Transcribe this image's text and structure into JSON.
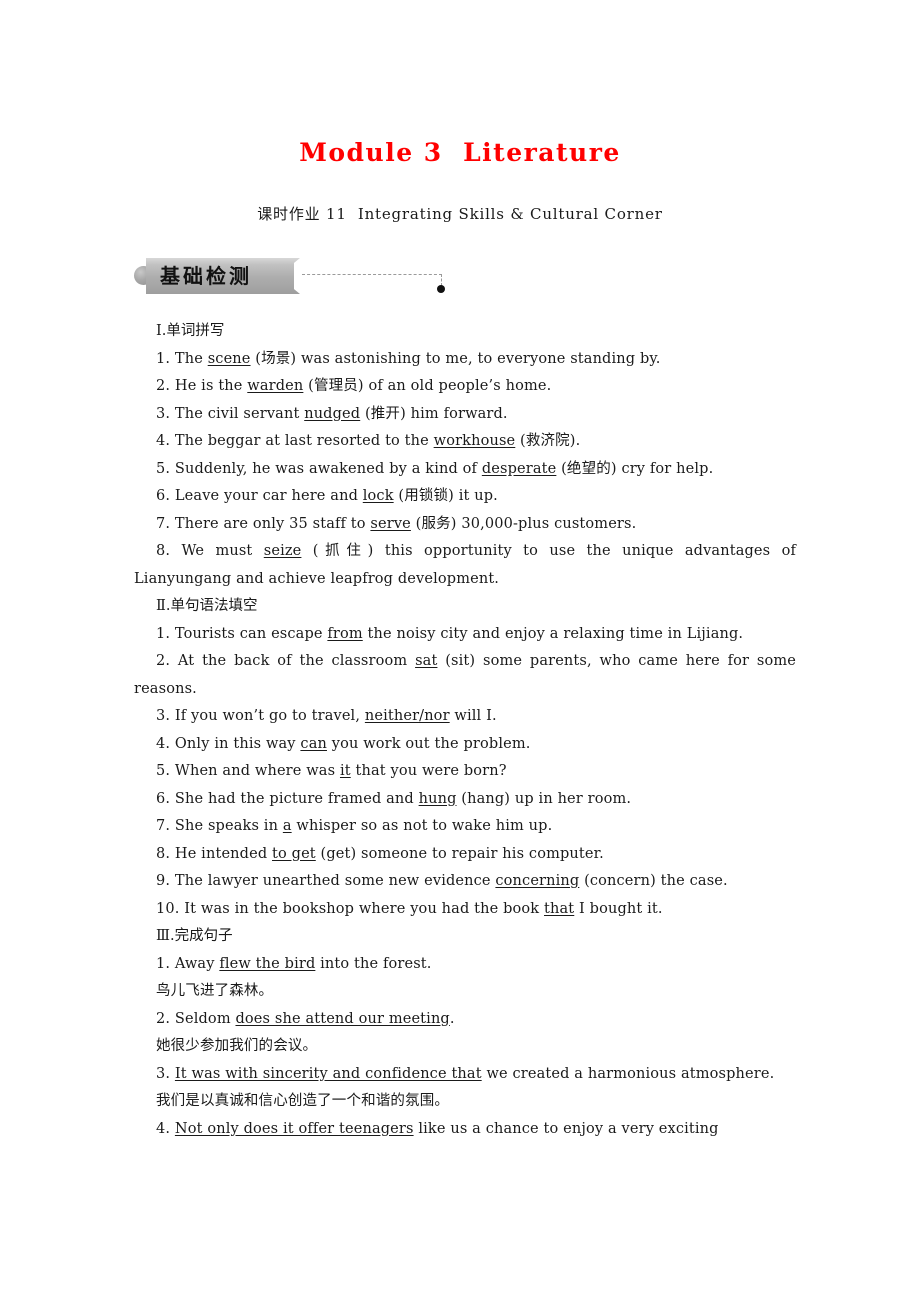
{
  "header": {
    "module_title": "Module 3  Literature",
    "worksheet_title": "课时作业 11  Integrating Skills & Cultural Corner"
  },
  "banner": {
    "label": "基础检测",
    "ribbon_color": "#aeaeae",
    "dash_color": "#9a9a9a",
    "dot_color": "#111111"
  },
  "sections": [
    {
      "heading": "Ⅰ.单词拼写",
      "items": [
        {
          "no": "1.",
          "pre": " The ",
          "ans": "scene",
          "post": " (场景) was astonishing to me, to everyone standing by."
        },
        {
          "no": "2.",
          "pre": " He is the ",
          "ans": "warden",
          "post": " (管理员) of an old people’s home."
        },
        {
          "no": "3.",
          "pre": " The civil servant ",
          "ans": "nudged",
          "post": " (推开) him forward."
        },
        {
          "no": "4.",
          "pre": " The beggar at last resorted to the ",
          "ans": "workhouse",
          "post": " (救济院)."
        },
        {
          "no": "5.",
          "pre": " Suddenly, he was awakened by a kind of ",
          "ans": "desperate",
          "post": " (绝望的) cry for help."
        },
        {
          "no": "6.",
          "pre": " Leave your car here and ",
          "ans": "lock",
          "post": " (用锁锁) it up."
        },
        {
          "no": "7.",
          "pre": " There are only 35 staff to ",
          "ans": "serve",
          "post": " (服务) 30,000-plus customers."
        },
        {
          "no": "8.",
          "pre": " We must ",
          "ans": "seize",
          "post": " (抓住) this opportunity to use the unique advantages of Lianyungang and achieve leapfrog development."
        }
      ]
    },
    {
      "heading": "Ⅱ.单句语法填空",
      "items": [
        {
          "no": "1.",
          "pre": " Tourists can escape ",
          "ans": "from",
          "post": " the noisy city and enjoy a relaxing time in Lijiang."
        },
        {
          "no": "2.",
          "pre": " At the back of the classroom ",
          "ans": "sat",
          "post": " (sit) some parents, who came here for some reasons."
        },
        {
          "no": "3.",
          "pre": " If you won’t go to travel, ",
          "ans": "neither/nor",
          "post": " will I."
        },
        {
          "no": "4.",
          "pre": " Only in this way ",
          "ans": "can",
          "post": " you work out the problem."
        },
        {
          "no": "5.",
          "pre": " When and where was ",
          "ans": "it",
          "post": " that you were born?"
        },
        {
          "no": "6.",
          "pre": " She had the picture framed and ",
          "ans": "hung",
          "post": " (hang) up in her room."
        },
        {
          "no": "7.",
          "pre": " She speaks in ",
          "ans": "a",
          "post": " whisper so as not to wake him up."
        },
        {
          "no": "8.",
          "pre": " He intended ",
          "ans": "to get",
          "post": " (get) someone to repair his computer."
        },
        {
          "no": "9.",
          "pre": " The lawyer unearthed some new evidence ",
          "ans": "concerning",
          "post": " (concern) the case."
        },
        {
          "no": "10.",
          "pre": " It was in the bookshop where you had the book ",
          "ans": "that",
          "post": " I bought it."
        }
      ]
    },
    {
      "heading": "Ⅲ.完成句子",
      "items": [
        {
          "no": "1.",
          "pre": " Away ",
          "ans": "flew the bird",
          "post": " into the forest.",
          "cn": "鸟儿飞进了森林。"
        },
        {
          "no": "2.",
          "pre": " Seldom ",
          "ans": "does she attend our meeting",
          "post": ".",
          "cn": "她很少参加我们的会议。"
        },
        {
          "no": "3.",
          "pre": " ",
          "ans": "It was with sincerity and confidence that",
          "post": " we created a harmonious atmosphere.",
          "cn": "我们是以真诚和信心创造了一个和谐的氛围。"
        },
        {
          "no": "4.",
          "pre": " ",
          "ans": "Not only does it offer teenagers",
          "post": " like us a chance to enjoy a very exciting",
          "cn": ""
        }
      ]
    }
  ]
}
